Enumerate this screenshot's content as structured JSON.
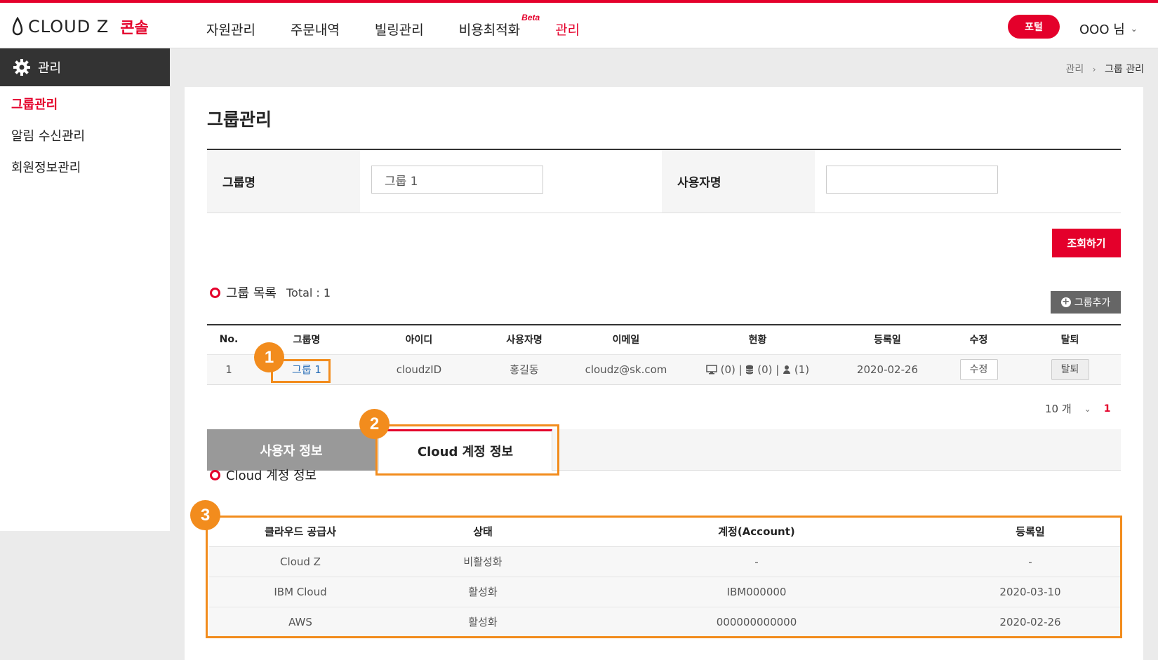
{
  "header": {
    "brand": "CLOUD Z",
    "console": "콘솔",
    "nav": [
      "자원관리",
      "주문내역",
      "빌링관리",
      "비용최적화",
      "관리"
    ],
    "beta": "Beta",
    "portal": "포털",
    "user": "OOO 님"
  },
  "sidebar": {
    "title": "관리",
    "items": [
      "그룹관리",
      "알림 수신관리",
      "회원정보관리"
    ]
  },
  "breadcrumb": {
    "root": "관리",
    "current": "그룹 관리"
  },
  "page": {
    "title": "그룹관리"
  },
  "search": {
    "group_label": "그룹명",
    "group_value": "그룹 1",
    "user_label": "사용자명",
    "user_value": "",
    "search_button": "조회하기"
  },
  "group_list": {
    "title": "그룹 목록",
    "total": "Total : 1",
    "add_button": "그룹추가",
    "columns": [
      "No.",
      "그룹명",
      "아이디",
      "사용자명",
      "이메일",
      "현황",
      "등록일",
      "수정",
      "탈퇴"
    ],
    "rows": [
      {
        "no": "1",
        "group": "그룹 1",
        "id": "cloudzID",
        "user": "홍길동",
        "email": "cloudz@sk.com",
        "status_vm": "(0) |",
        "status_db": "(0) |",
        "status_user": "(1)",
        "date": "2020-02-26",
        "edit": "수정",
        "leave": "탈퇴"
      }
    ]
  },
  "pager": {
    "page_size": "10 개",
    "page": "1"
  },
  "tabs": [
    "사용자 정보",
    "Cloud 계정 정보"
  ],
  "cloud_accounts": {
    "title": "Cloud 계정 정보",
    "columns": [
      "클라우드 공급사",
      "상태",
      "계정(Account)",
      "등록일"
    ],
    "rows": [
      [
        "Cloud Z",
        "비활성화",
        "-",
        "-"
      ],
      [
        "IBM Cloud",
        "활성화",
        "IBM000000",
        "2020-03-10"
      ],
      [
        "AWS",
        "활성화",
        "000000000000",
        "2020-02-26"
      ]
    ]
  },
  "callouts": [
    "1",
    "2",
    "3"
  ],
  "colors": {
    "accent": "#e4002b",
    "callout": "#f28c1d",
    "dark": "#333333"
  }
}
